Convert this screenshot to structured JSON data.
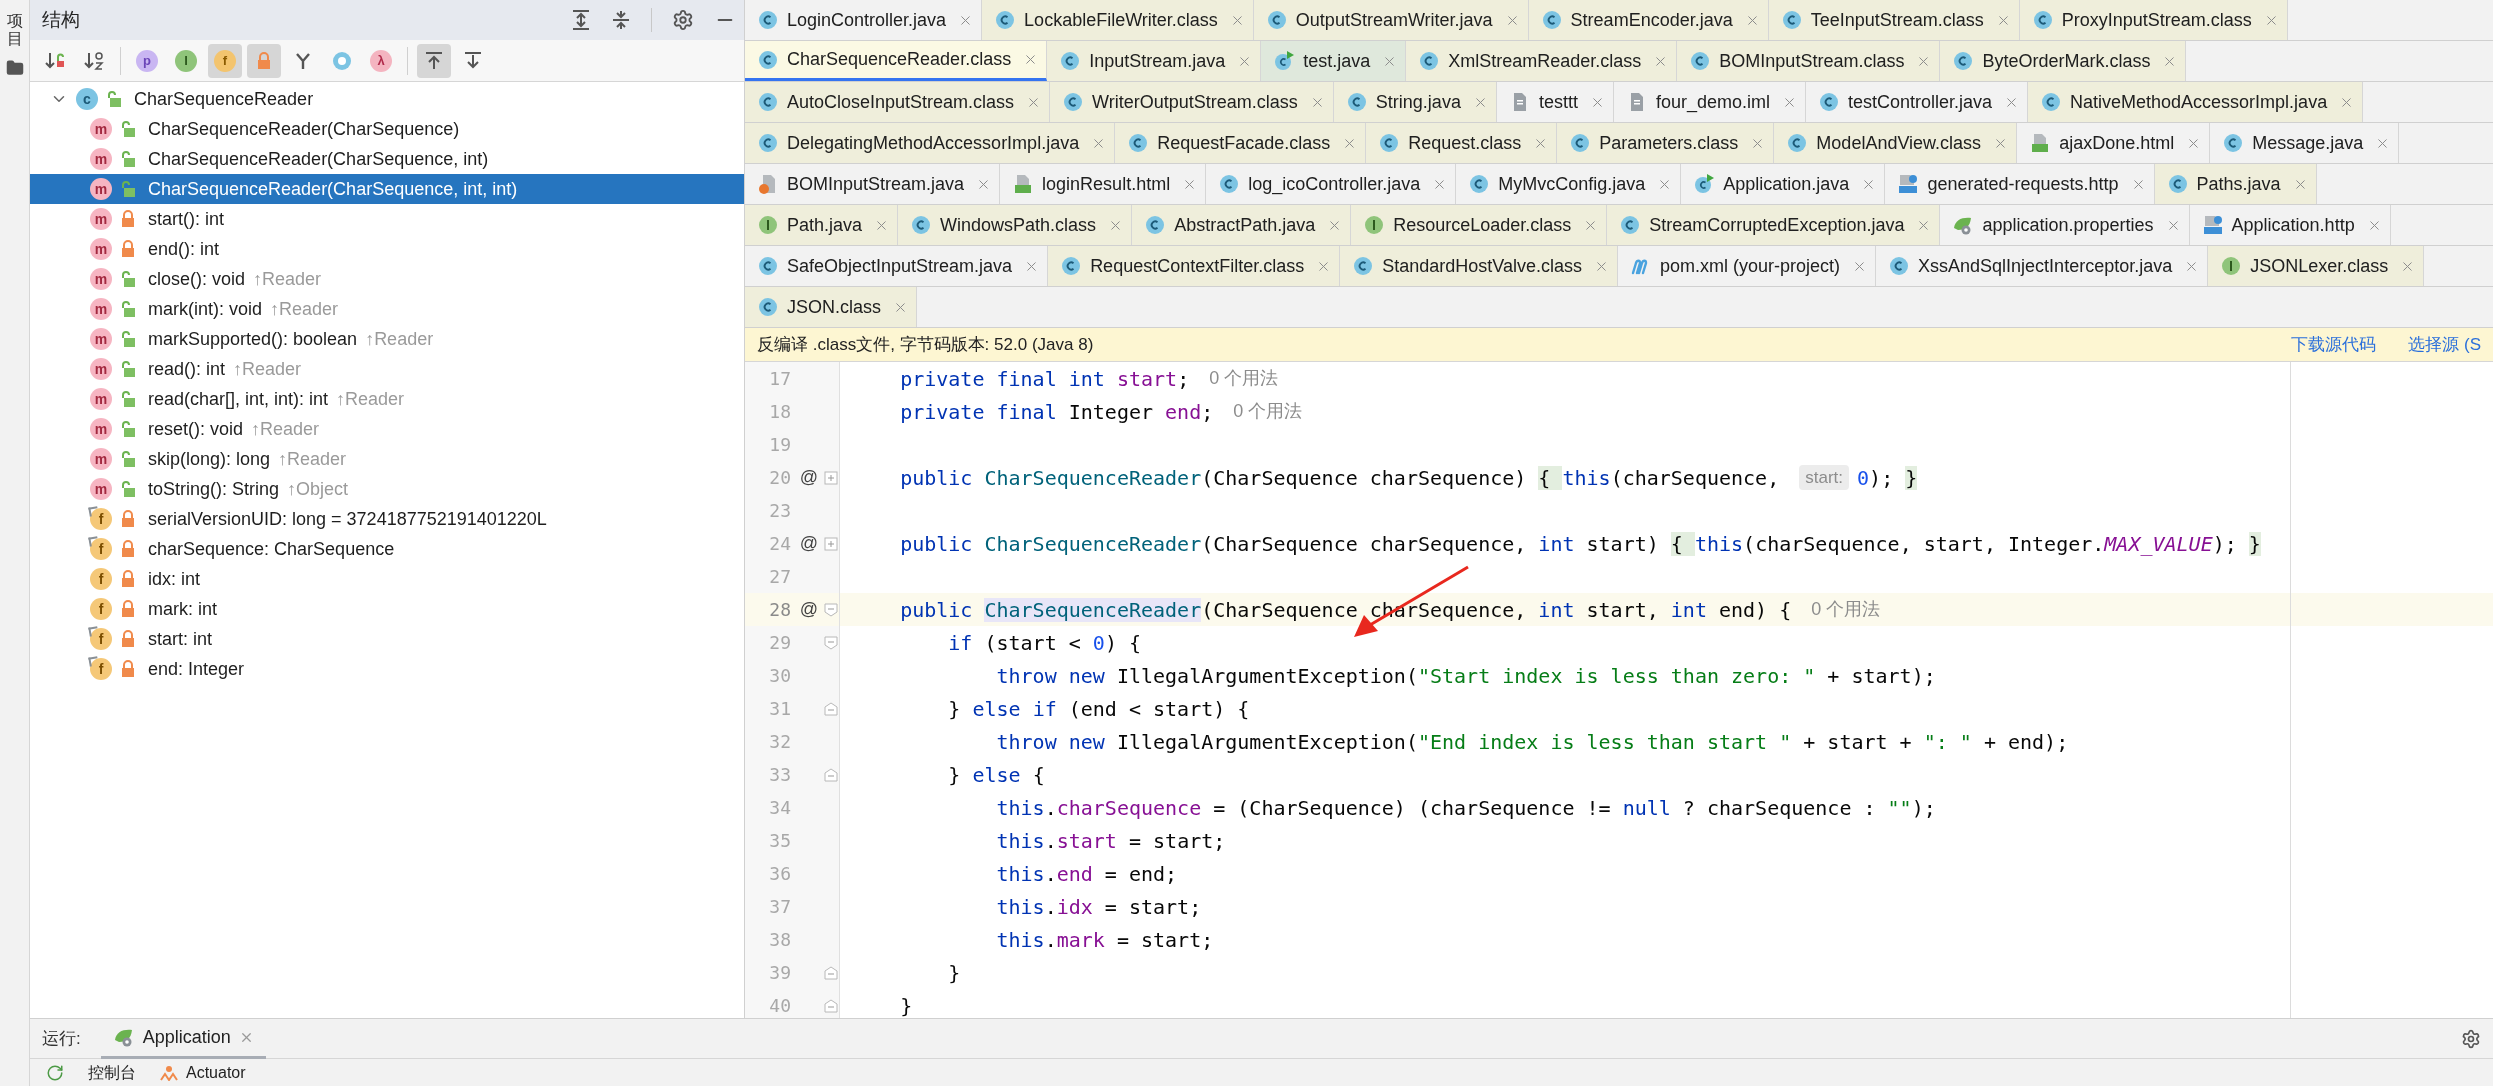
{
  "left_strip": {
    "project_label": "项目"
  },
  "structure": {
    "title": "结构",
    "toolbar": [
      {
        "kind": "sort_visibility",
        "selected": false
      },
      {
        "kind": "sort_alpha",
        "selected": false
      },
      {
        "kind": "public",
        "letter": "p",
        "selected": false
      },
      {
        "kind": "inherited",
        "letter": "I",
        "selected": false
      },
      {
        "kind": "fields",
        "letter": "f",
        "selected": true
      },
      {
        "kind": "nonpublic",
        "selected": true
      },
      {
        "kind": "hierarchy",
        "selected": false
      },
      {
        "kind": "anonymous",
        "selected": false
      },
      {
        "kind": "lambda",
        "letter": "λ",
        "selected": false
      },
      {
        "kind": "scroll_to",
        "selected": true
      },
      {
        "kind": "scroll_from",
        "selected": false
      }
    ],
    "tree": [
      {
        "name": "CharSequenceReader",
        "kind": "class",
        "letter": "c",
        "private": false,
        "final": false,
        "expanded": true,
        "selected": false,
        "children": [
          {
            "name": "CharSequenceReader(CharSequence)",
            "kind": "method",
            "letter": "m",
            "private": false,
            "final": false,
            "selected": false
          },
          {
            "name": "CharSequenceReader(CharSequence, int)",
            "kind": "method",
            "letter": "m",
            "private": false,
            "final": false,
            "selected": false
          },
          {
            "name": "CharSequenceReader(CharSequence, int, int)",
            "kind": "method",
            "letter": "m",
            "private": false,
            "final": false,
            "selected": true
          },
          {
            "name": "start(): int",
            "kind": "method",
            "letter": "m",
            "private": true,
            "final": false,
            "selected": false
          },
          {
            "name": "end(): int",
            "kind": "method",
            "letter": "m",
            "private": true,
            "final": false,
            "selected": false
          },
          {
            "name": "close(): void",
            "origin": "↑Reader",
            "kind": "method",
            "letter": "m",
            "private": false,
            "final": false,
            "selected": false
          },
          {
            "name": "mark(int): void",
            "origin": "↑Reader",
            "kind": "method",
            "letter": "m",
            "private": false,
            "final": false,
            "selected": false
          },
          {
            "name": "markSupported(): boolean",
            "origin": "↑Reader",
            "kind": "method",
            "letter": "m",
            "private": false,
            "final": false,
            "selected": false
          },
          {
            "name": "read(): int",
            "origin": "↑Reader",
            "kind": "method",
            "letter": "m",
            "private": false,
            "final": false,
            "selected": false
          },
          {
            "name": "read(char[], int, int): int",
            "origin": "↑Reader",
            "kind": "method",
            "letter": "m",
            "private": false,
            "final": false,
            "selected": false
          },
          {
            "name": "reset(): void",
            "origin": "↑Reader",
            "kind": "method",
            "letter": "m",
            "private": false,
            "final": false,
            "selected": false
          },
          {
            "name": "skip(long): long",
            "origin": "↑Reader",
            "kind": "method",
            "letter": "m",
            "private": false,
            "final": false,
            "selected": false
          },
          {
            "name": "toString(): String",
            "origin": "↑Object",
            "kind": "method",
            "letter": "m",
            "private": false,
            "final": false,
            "selected": false
          },
          {
            "name": "serialVersionUID: long = 3724187752191401220L",
            "kind": "field",
            "letter": "f",
            "private": true,
            "final": true,
            "selected": false
          },
          {
            "name": "charSequence: CharSequence",
            "kind": "field",
            "letter": "f",
            "private": true,
            "final": true,
            "selected": false
          },
          {
            "name": "idx: int",
            "kind": "field",
            "letter": "f",
            "private": true,
            "final": false,
            "selected": false
          },
          {
            "name": "mark: int",
            "kind": "field",
            "letter": "f",
            "private": true,
            "final": false,
            "selected": false
          },
          {
            "name": "start: int",
            "kind": "field",
            "letter": "f",
            "private": true,
            "final": true,
            "selected": false
          },
          {
            "name": "end: Integer",
            "kind": "field",
            "letter": "f",
            "private": true,
            "final": true,
            "selected": false
          }
        ]
      }
    ]
  },
  "tab_rows": [
    [
      {
        "label": "LoginController.java",
        "kind": "class",
        "color": "#f2f2f2",
        "selected": false
      },
      {
        "label": "LockableFileWriter.class",
        "kind": "class",
        "color": "#efeedb",
        "selected": false
      },
      {
        "label": "OutputStreamWriter.java",
        "kind": "class",
        "color": "#efeedb",
        "selected": false
      },
      {
        "label": "StreamEncoder.java",
        "kind": "class",
        "color": "#efeedb",
        "selected": false
      },
      {
        "label": "TeeInputStream.class",
        "kind": "class",
        "color": "#efeedb",
        "selected": false
      },
      {
        "label": "ProxyInputStream.class",
        "kind": "class",
        "color": "#efeedb",
        "selected": false
      }
    ],
    [
      {
        "label": "CharSequenceReader.class",
        "kind": "class",
        "color": "#fbf9e4",
        "selected": true
      },
      {
        "label": "InputStream.java",
        "kind": "class",
        "color": "#efeedb",
        "selected": false
      },
      {
        "label": "test.java",
        "kind": "run",
        "color": "#dfe8dc",
        "selected": false
      },
      {
        "label": "XmlStreamReader.class",
        "kind": "class",
        "color": "#efeedb",
        "selected": false
      },
      {
        "label": "BOMInputStream.class",
        "kind": "class",
        "color": "#efeedb",
        "selected": false
      },
      {
        "label": "ByteOrderMark.class",
        "kind": "class",
        "color": "#efeedb",
        "selected": false
      }
    ],
    [
      {
        "label": "AutoCloseInputStream.class",
        "kind": "class",
        "color": "#efeedb",
        "selected": false
      },
      {
        "label": "WriterOutputStream.class",
        "kind": "class",
        "color": "#efeedb",
        "selected": false
      },
      {
        "label": "String.java",
        "kind": "class",
        "color": "#efeedb",
        "selected": false
      },
      {
        "label": "testtt",
        "kind": "file",
        "color": "#f2f2f2",
        "selected": false
      },
      {
        "label": "four_demo.iml",
        "kind": "file",
        "color": "#f2f2f2",
        "selected": false
      },
      {
        "label": "testController.java",
        "kind": "class",
        "color": "#f2f2f2",
        "selected": false
      },
      {
        "label": "NativeMethodAccessorImpl.java",
        "kind": "class",
        "color": "#efeedb",
        "selected": false
      }
    ],
    [
      {
        "label": "DelegatingMethodAccessorImpl.java",
        "kind": "class",
        "color": "#efeedb",
        "selected": false
      },
      {
        "label": "RequestFacade.class",
        "kind": "class",
        "color": "#efeedb",
        "selected": false
      },
      {
        "label": "Request.class",
        "kind": "class",
        "color": "#efeedb",
        "selected": false
      },
      {
        "label": "Parameters.class",
        "kind": "class",
        "color": "#efeedb",
        "selected": false
      },
      {
        "label": "ModelAndView.class",
        "kind": "class",
        "color": "#efeedb",
        "selected": false
      },
      {
        "label": "ajaxDone.html",
        "kind": "html",
        "color": "#f2f2f2",
        "selected": false
      },
      {
        "label": "Message.java",
        "kind": "class",
        "color": "#f2f2f2",
        "selected": false
      }
    ],
    [
      {
        "label": "BOMInputStream.java",
        "kind": "jar",
        "color": "#f2f2f2",
        "selected": false
      },
      {
        "label": "loginResult.html",
        "kind": "html",
        "color": "#f2f2f2",
        "selected": false
      },
      {
        "label": "log_icoController.java",
        "kind": "class",
        "color": "#f2f2f2",
        "selected": false
      },
      {
        "label": "MyMvcConfig.java",
        "kind": "class",
        "color": "#f2f2f2",
        "selected": false
      },
      {
        "label": "Application.java",
        "kind": "run",
        "color": "#f2f2f2",
        "selected": false
      },
      {
        "label": "generated-requests.http",
        "kind": "api",
        "color": "#f2f2f2",
        "selected": false
      },
      {
        "label": "Paths.java",
        "kind": "class",
        "color": "#efeedb",
        "selected": false
      }
    ],
    [
      {
        "label": "Path.java",
        "kind": "interface",
        "color": "#efeedb",
        "selected": false
      },
      {
        "label": "WindowsPath.class",
        "kind": "class",
        "color": "#efeedb",
        "selected": false
      },
      {
        "label": "AbstractPath.java",
        "kind": "class",
        "color": "#efeedb",
        "selected": false
      },
      {
        "label": "ResourceLoader.class",
        "kind": "interface",
        "color": "#efeedb",
        "selected": false
      },
      {
        "label": "StreamCorruptedException.java",
        "kind": "class",
        "color": "#efeedb",
        "selected": false
      },
      {
        "label": "application.properties",
        "kind": "spring",
        "color": "#f2f2f2",
        "selected": false
      },
      {
        "label": "Application.http",
        "kind": "api",
        "color": "#f2f2f2",
        "selected": false
      }
    ],
    [
      {
        "label": "SafeObjectInputStream.java",
        "kind": "class",
        "color": "#f2f2f2",
        "selected": false
      },
      {
        "label": "RequestContextFilter.class",
        "kind": "class",
        "color": "#efeedb",
        "selected": false
      },
      {
        "label": "StandardHostValve.class",
        "kind": "class",
        "color": "#efeedb",
        "selected": false
      },
      {
        "label": "pom.xml (your-project)",
        "kind": "maven",
        "color": "#f2f2f2",
        "selected": false
      },
      {
        "label": "XssAndSqlInjectInterceptor.java",
        "kind": "class",
        "color": "#f2f2f2",
        "selected": false
      },
      {
        "label": "JSONLexer.class",
        "kind": "interface",
        "color": "#efeedb",
        "selected": false
      }
    ],
    [
      {
        "label": "JSON.class",
        "kind": "class",
        "color": "#efeedb",
        "selected": false
      }
    ]
  ],
  "banner": {
    "text": "反编译 .class文件, 字节码版本: 52.0 (Java 8)",
    "links": [
      "下载源代码",
      "选择源 (S"
    ]
  },
  "code_lines": [
    {
      "number": "17",
      "kind": "plain",
      "current": false,
      "tokens": [
        {
          "kind": "kw",
          "text": "    private final int "
        },
        {
          "kind": "field",
          "text": "start"
        },
        {
          "kind": "plain",
          "text": ";"
        },
        {
          "kind": "hint",
          "text": "0 个用法"
        }
      ]
    },
    {
      "number": "18",
      "kind": "plain",
      "current": false,
      "tokens": [
        {
          "kind": "kw",
          "text": "    private final "
        },
        {
          "kind": "plain",
          "text": "Integer "
        },
        {
          "kind": "field",
          "text": "end"
        },
        {
          "kind": "plain",
          "text": ";"
        },
        {
          "kind": "hint",
          "text": "0 个用法"
        }
      ]
    },
    {
      "number": "19",
      "kind": "plain",
      "current": false
    },
    {
      "number": "20",
      "marker": "@",
      "kind": "fold_expand",
      "current": false,
      "tokens": [
        {
          "kind": "kw",
          "text": "    public "
        },
        {
          "kind": "method",
          "text": "CharSequenceReader"
        },
        {
          "kind": "plain",
          "text": "(CharSequence charSequence) "
        },
        {
          "kind": "fold",
          "text": "{ "
        },
        {
          "kind": "kw",
          "text": "this"
        },
        {
          "kind": "plain",
          "text": "(charSequence, "
        },
        {
          "kind": "param",
          "text": "start:"
        },
        {
          "kind": "number",
          "text": "0"
        },
        {
          "kind": "plain",
          "text": "); "
        },
        {
          "kind": "fold",
          "text": "}"
        }
      ]
    },
    {
      "number": "23",
      "kind": "plain",
      "current": false
    },
    {
      "number": "24",
      "marker": "@",
      "kind": "fold_expand",
      "current": false,
      "tokens": [
        {
          "kind": "kw",
          "text": "    public "
        },
        {
          "kind": "method",
          "text": "CharSequenceReader"
        },
        {
          "kind": "plain",
          "text": "(CharSequence charSequence, "
        },
        {
          "kind": "kw",
          "text": "int "
        },
        {
          "kind": "plain",
          "text": "start) "
        },
        {
          "kind": "fold",
          "text": "{ "
        },
        {
          "kind": "kw",
          "text": "this"
        },
        {
          "kind": "plain",
          "text": "(charSequence, start, Integer."
        },
        {
          "kind": "static",
          "text": "MAX_VALUE"
        },
        {
          "kind": "plain",
          "text": "); "
        },
        {
          "kind": "fold",
          "text": "}"
        }
      ]
    },
    {
      "number": "27",
      "kind": "plain",
      "current": false
    },
    {
      "number": "28",
      "marker": "@",
      "kind": "fold_start",
      "current": true,
      "tokens": [
        {
          "kind": "kw",
          "text": "    public "
        },
        {
          "kind": "method_hl",
          "text": "CharSequenceReader"
        },
        {
          "kind": "plain",
          "text": "(CharSequence charSequence, "
        },
        {
          "kind": "kw",
          "text": "int "
        },
        {
          "kind": "plain",
          "text": "start, "
        },
        {
          "kind": "kw",
          "text": "int "
        },
        {
          "kind": "plain",
          "text": "end) {"
        },
        {
          "kind": "hint",
          "text": "0 个用法"
        }
      ]
    },
    {
      "number": "29",
      "kind": "fold_start",
      "current": false,
      "tokens": [
        {
          "kind": "kw",
          "text": "        if "
        },
        {
          "kind": "plain",
          "text": "(start < "
        },
        {
          "kind": "number",
          "text": "0"
        },
        {
          "kind": "plain",
          "text": ") {"
        }
      ]
    },
    {
      "number": "30",
      "kind": "plain",
      "current": false,
      "tokens": [
        {
          "kind": "kw",
          "text": "            throw new "
        },
        {
          "kind": "plain",
          "text": "IllegalArgumentException("
        },
        {
          "kind": "string",
          "text": "\"Start index is less than zero: \""
        },
        {
          "kind": "plain",
          "text": " + start);"
        }
      ]
    },
    {
      "number": "31",
      "kind": "fold_end",
      "current": false,
      "tokens": [
        {
          "kind": "plain",
          "text": "        } "
        },
        {
          "kind": "kw",
          "text": "else if "
        },
        {
          "kind": "plain",
          "text": "(end < start) {"
        }
      ]
    },
    {
      "number": "32",
      "kind": "plain",
      "current": false,
      "tokens": [
        {
          "kind": "kw",
          "text": "            throw new "
        },
        {
          "kind": "plain",
          "text": "IllegalArgumentException("
        },
        {
          "kind": "string",
          "text": "\"End index is less than start \""
        },
        {
          "kind": "plain",
          "text": " + start + "
        },
        {
          "kind": "string",
          "text": "\": \""
        },
        {
          "kind": "plain",
          "text": " + end);"
        }
      ]
    },
    {
      "number": "33",
      "kind": "fold_end",
      "current": false,
      "tokens": [
        {
          "kind": "plain",
          "text": "        } "
        },
        {
          "kind": "kw",
          "text": "else "
        },
        {
          "kind": "plain",
          "text": "{"
        }
      ]
    },
    {
      "number": "34",
      "kind": "plain",
      "current": false,
      "tokens": [
        {
          "kind": "kw",
          "text": "            this"
        },
        {
          "kind": "plain",
          "text": "."
        },
        {
          "kind": "field",
          "text": "charSequence"
        },
        {
          "kind": "plain",
          "text": " = (CharSequence) (charSequence != "
        },
        {
          "kind": "kw",
          "text": "null"
        },
        {
          "kind": "plain",
          "text": " ? charSequence : "
        },
        {
          "kind": "string",
          "text": "\"\""
        },
        {
          "kind": "plain",
          "text": ");"
        }
      ]
    },
    {
      "number": "35",
      "kind": "plain",
      "current": false,
      "tokens": [
        {
          "kind": "kw",
          "text": "            this"
        },
        {
          "kind": "plain",
          "text": "."
        },
        {
          "kind": "field",
          "text": "start"
        },
        {
          "kind": "plain",
          "text": " = start;"
        }
      ]
    },
    {
      "number": "36",
      "kind": "plain",
      "current": false,
      "tokens": [
        {
          "kind": "kw",
          "text": "            this"
        },
        {
          "kind": "plain",
          "text": "."
        },
        {
          "kind": "field",
          "text": "end"
        },
        {
          "kind": "plain",
          "text": " = end;"
        }
      ]
    },
    {
      "number": "37",
      "kind": "plain",
      "current": false,
      "tokens": [
        {
          "kind": "kw",
          "text": "            this"
        },
        {
          "kind": "plain",
          "text": "."
        },
        {
          "kind": "field",
          "text": "idx"
        },
        {
          "kind": "plain",
          "text": " = start;"
        }
      ]
    },
    {
      "number": "38",
      "kind": "plain",
      "current": false,
      "tokens": [
        {
          "kind": "kw",
          "text": "            this"
        },
        {
          "kind": "plain",
          "text": "."
        },
        {
          "kind": "field",
          "text": "mark"
        },
        {
          "kind": "plain",
          "text": " = start;"
        }
      ]
    },
    {
      "number": "39",
      "kind": "fold_end",
      "current": false,
      "tokens": [
        {
          "kind": "plain",
          "text": "        }"
        }
      ]
    },
    {
      "number": "40",
      "kind": "fold_end",
      "current": false,
      "tokens": [
        {
          "kind": "plain",
          "text": "    }"
        }
      ]
    }
  ],
  "run_panel": {
    "label": "运行:",
    "tabs": [
      {
        "label": "Application",
        "selected": true
      }
    ],
    "tools": [
      {
        "label": "控制台",
        "kind": "console"
      },
      {
        "label": "Actuator",
        "kind": "actuator"
      }
    ]
  }
}
